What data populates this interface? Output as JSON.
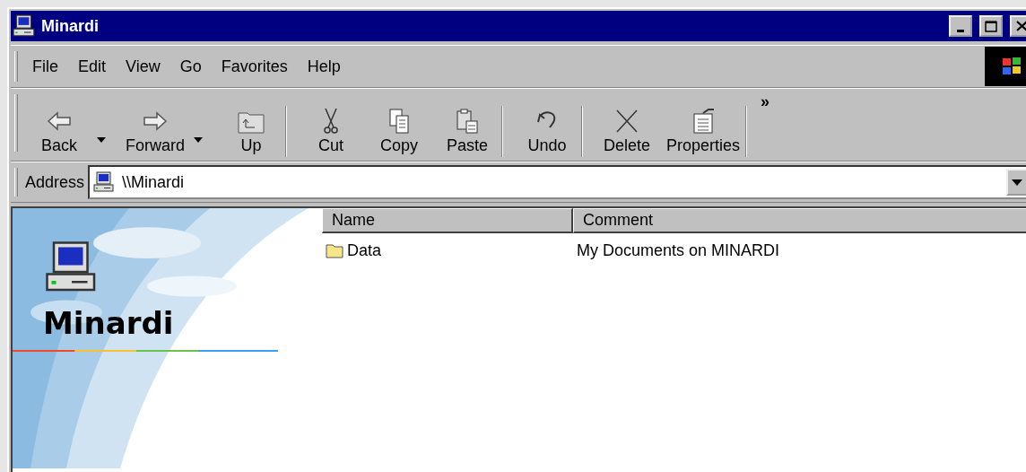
{
  "window": {
    "title": "Minardi"
  },
  "menu": [
    "File",
    "Edit",
    "View",
    "Go",
    "Favorites",
    "Help"
  ],
  "toolbar": {
    "buttons": [
      {
        "label": "Back",
        "dropdown": true,
        "separator_after": false
      },
      {
        "label": "Forward",
        "dropdown": true,
        "separator_after": false
      },
      {
        "label": "Up",
        "dropdown": false,
        "separator_after": true
      },
      {
        "label": "Cut",
        "dropdown": false,
        "separator_after": false
      },
      {
        "label": "Copy",
        "dropdown": false,
        "separator_after": false
      },
      {
        "label": "Paste",
        "dropdown": false,
        "separator_after": true
      },
      {
        "label": "Undo",
        "dropdown": false,
        "separator_after": true
      },
      {
        "label": "Delete",
        "dropdown": false,
        "separator_after": false
      },
      {
        "label": "Properties",
        "dropdown": false,
        "separator_after": true
      }
    ],
    "more": "»"
  },
  "address": {
    "label": "Address",
    "value": "\\\\Minardi"
  },
  "panel": {
    "title": "Minardi"
  },
  "list": {
    "columns": [
      "Name",
      "Comment"
    ],
    "rows": [
      {
        "name": "Data",
        "comment": "My Documents on MINARDI"
      }
    ]
  }
}
